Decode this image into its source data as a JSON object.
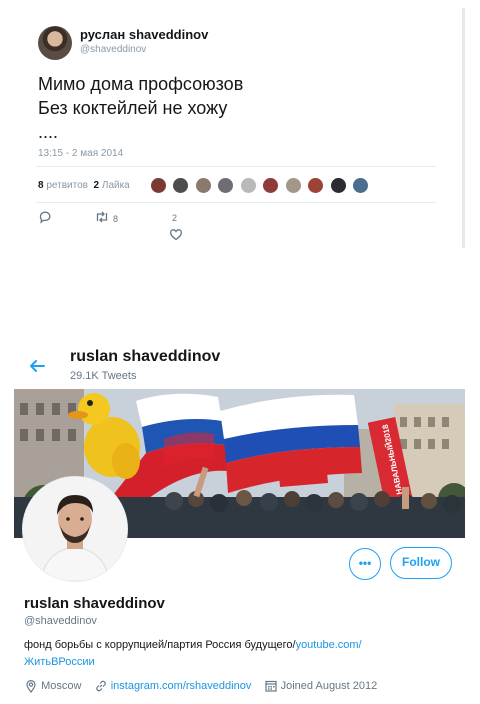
{
  "tweet": {
    "author_name": "руслан shaveddinov",
    "author_handle": "@shaveddinov",
    "text_lines": [
      "Мимо дома профсоюзов",
      "Без коктейлей не хожу",
      "...."
    ],
    "timestamp": "13:15 - 2 мая 2014",
    "retweets_count": "8",
    "retweets_label": "ретвитов",
    "likes_count": "2",
    "likes_label": "Лайка",
    "reply_action_count": "",
    "retweet_action_count": "8",
    "like_action_count": "2"
  },
  "profile": {
    "header_name": "ruslan shaveddinov",
    "tweet_count": "29.1K Tweets",
    "name": "ruslan shaveddinov",
    "handle": "@shaveddinov",
    "bio_text": "фонд борьбы с коррупцией/партия Россия будущего/",
    "bio_link1": "youtube.com/",
    "bio_link2": "ЖитьВРоссии",
    "follow_label": "Follow",
    "more_label": "•••",
    "location": "Moscow",
    "website": "instagram.com/rshaveddinov",
    "joined": "Joined August 2012",
    "banner_sign": "НАВАЛЬНЫЙ2018"
  },
  "colors": {
    "accent": "#1da1f2",
    "link": "#1b95e0",
    "secondary_text": "#657786"
  }
}
